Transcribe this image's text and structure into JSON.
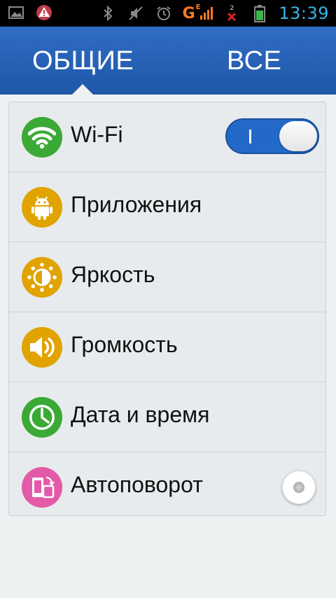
{
  "status_bar": {
    "time": "13:39",
    "network_type": "G",
    "network_sub": "E",
    "sim2_label": "2",
    "icons": [
      "image-icon",
      "alert-icon",
      "bluetooth-icon",
      "mute-icon",
      "alarm-icon",
      "signal-icon",
      "no-signal-icon",
      "battery-icon"
    ]
  },
  "tabs": [
    {
      "label": "ОБЩИЕ",
      "selected": true
    },
    {
      "label": "ВСЕ",
      "selected": false
    }
  ],
  "settings": [
    {
      "label": "Wi-Fi",
      "icon": "wifi-icon",
      "color": "#3aa935",
      "control": "toggle",
      "enabled": true
    },
    {
      "label": "Приложения",
      "icon": "android-icon",
      "color": "#e0a300"
    },
    {
      "label": "Яркость",
      "icon": "brightness-icon",
      "color": "#e0a300"
    },
    {
      "label": "Громкость",
      "icon": "volume-icon",
      "color": "#e0a300"
    },
    {
      "label": "Дата и время",
      "icon": "clock-icon",
      "color": "#3aa935"
    },
    {
      "label": "Автоповорот",
      "icon": "rotate-icon",
      "color": "#e35aa8",
      "control": "radio",
      "enabled": false
    }
  ],
  "colors": {
    "header": "#2a63b8",
    "toggle_on": "#2369c7",
    "status_time": "#39b5e8"
  }
}
